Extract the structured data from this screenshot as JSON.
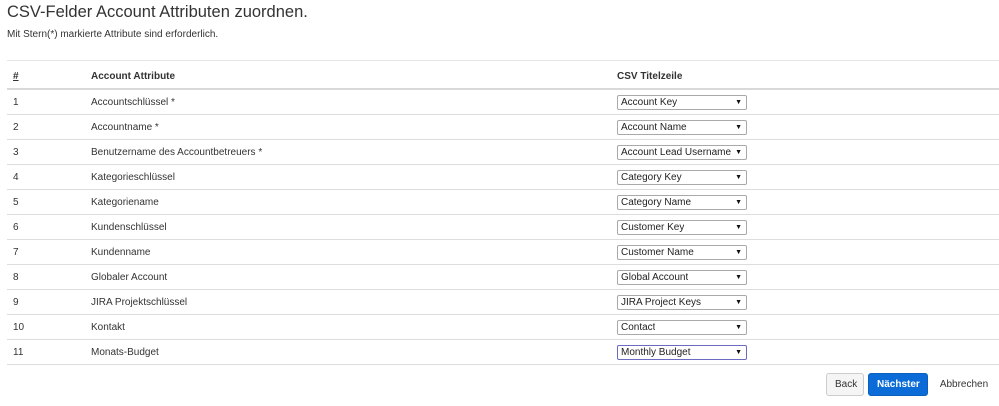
{
  "page": {
    "title": "CSV-Felder Account Attributen zuordnen.",
    "subtitle": "Mit Stern(*) markierte Attribute sind erforderlich."
  },
  "table": {
    "headers": {
      "number": "#",
      "attribute": "Account Attribute",
      "csv": "CSV Titelzeile"
    },
    "rows": [
      {
        "num": "1",
        "attribute": "Accountschlüssel *",
        "csv": "Account Key"
      },
      {
        "num": "2",
        "attribute": "Accountname *",
        "csv": "Account Name"
      },
      {
        "num": "3",
        "attribute": "Benutzername des Accountbetreuers *",
        "csv": "Account Lead Username"
      },
      {
        "num": "4",
        "attribute": "Kategorieschlüssel",
        "csv": "Category Key"
      },
      {
        "num": "5",
        "attribute": "Kategoriename",
        "csv": "Category Name"
      },
      {
        "num": "6",
        "attribute": "Kundenschlüssel",
        "csv": "Customer Key"
      },
      {
        "num": "7",
        "attribute": "Kundenname",
        "csv": "Customer Name"
      },
      {
        "num": "8",
        "attribute": "Globaler Account",
        "csv": "Global Account"
      },
      {
        "num": "9",
        "attribute": "JIRA Projektschlüssel",
        "csv": "JIRA Project Keys"
      },
      {
        "num": "10",
        "attribute": "Kontakt",
        "csv": "Contact"
      },
      {
        "num": "11",
        "attribute": "Monats-Budget",
        "csv": "Monthly Budget"
      }
    ]
  },
  "buttons": {
    "back": "Back",
    "next": "Nächster",
    "cancel": "Abbrechen"
  },
  "icons": {
    "select_arrow": "triangle-down-icon"
  },
  "colors": {
    "primary": "#0b6cd8",
    "focus_border": "#6b6bbf"
  }
}
